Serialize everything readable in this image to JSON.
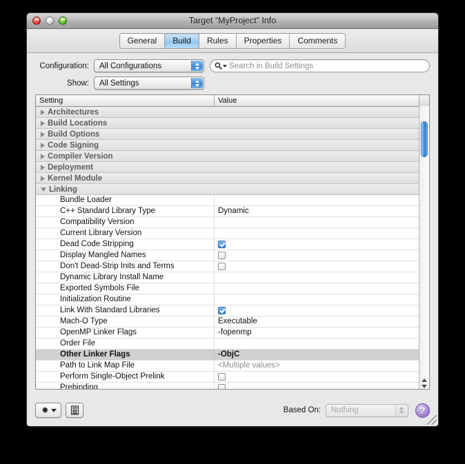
{
  "window": {
    "title": "Target “MyProject” Info",
    "traffic_lights": [
      "close",
      "minimize",
      "zoom"
    ]
  },
  "tabs": [
    {
      "label": "General",
      "selected": false
    },
    {
      "label": "Build",
      "selected": true
    },
    {
      "label": "Rules",
      "selected": false
    },
    {
      "label": "Properties",
      "selected": false
    },
    {
      "label": "Comments",
      "selected": false
    }
  ],
  "controls": {
    "configuration_label": "Configuration:",
    "configuration_value": "All Configurations",
    "show_label": "Show:",
    "show_value": "All Settings",
    "search_placeholder": "Search in Build Settings"
  },
  "table": {
    "columns": [
      "Setting",
      "Value"
    ],
    "rows": [
      {
        "type": "group",
        "label": "Architectures",
        "expanded": false
      },
      {
        "type": "group",
        "label": "Build Locations",
        "expanded": false
      },
      {
        "type": "group",
        "label": "Build Options",
        "expanded": false
      },
      {
        "type": "group",
        "label": "Code Signing",
        "expanded": false
      },
      {
        "type": "group",
        "label": "Compiler Version",
        "expanded": false
      },
      {
        "type": "group",
        "label": "Deployment",
        "expanded": false
      },
      {
        "type": "group",
        "label": "Kernel Module",
        "expanded": false
      },
      {
        "type": "group",
        "label": "Linking",
        "expanded": true
      },
      {
        "type": "setting",
        "name": "Bundle Loader",
        "value": "",
        "kind": "text"
      },
      {
        "type": "setting",
        "name": "C++ Standard Library Type",
        "value": "Dynamic",
        "kind": "text"
      },
      {
        "type": "setting",
        "name": "Compatibility Version",
        "value": "",
        "kind": "text"
      },
      {
        "type": "setting",
        "name": "Current Library Version",
        "value": "",
        "kind": "text"
      },
      {
        "type": "setting",
        "name": "Dead Code Stripping",
        "value": "",
        "kind": "checkbox",
        "checked": true
      },
      {
        "type": "setting",
        "name": "Display Mangled Names",
        "value": "",
        "kind": "checkbox",
        "checked": false
      },
      {
        "type": "setting",
        "name": "Don't Dead-Strip Inits and Terms",
        "value": "",
        "kind": "checkbox",
        "checked": false
      },
      {
        "type": "setting",
        "name": "Dynamic Library Install Name",
        "value": "",
        "kind": "text"
      },
      {
        "type": "setting",
        "name": "Exported Symbols File",
        "value": "",
        "kind": "text"
      },
      {
        "type": "setting",
        "name": "Initialization Routine",
        "value": "",
        "kind": "text"
      },
      {
        "type": "setting",
        "name": "Link With Standard Libraries",
        "value": "",
        "kind": "checkbox",
        "checked": true
      },
      {
        "type": "setting",
        "name": "Mach-O Type",
        "value": "Executable",
        "kind": "stepper"
      },
      {
        "type": "setting",
        "name": "OpenMP Linker Flags",
        "value": "-fopenmp",
        "kind": "text"
      },
      {
        "type": "setting",
        "name": "Order File",
        "value": "",
        "kind": "text"
      },
      {
        "type": "setting",
        "name": "Other Linker Flags",
        "value": "-ObjC",
        "kind": "text",
        "highlighted": true
      },
      {
        "type": "setting",
        "name": "Path to Link Map File",
        "value": "<Multiple values>",
        "kind": "placeholder"
      },
      {
        "type": "setting",
        "name": "Perform Single-Object Prelink",
        "value": "",
        "kind": "checkbox",
        "checked": false
      },
      {
        "type": "setting",
        "name": "Prebinding",
        "value": "",
        "kind": "checkbox",
        "checked": false
      }
    ]
  },
  "bottom": {
    "gear_icon": "gear-icon",
    "list_icon": "list-document-icon",
    "based_on_label": "Based On:",
    "based_on_value": "Nothing",
    "help_label": "?"
  }
}
